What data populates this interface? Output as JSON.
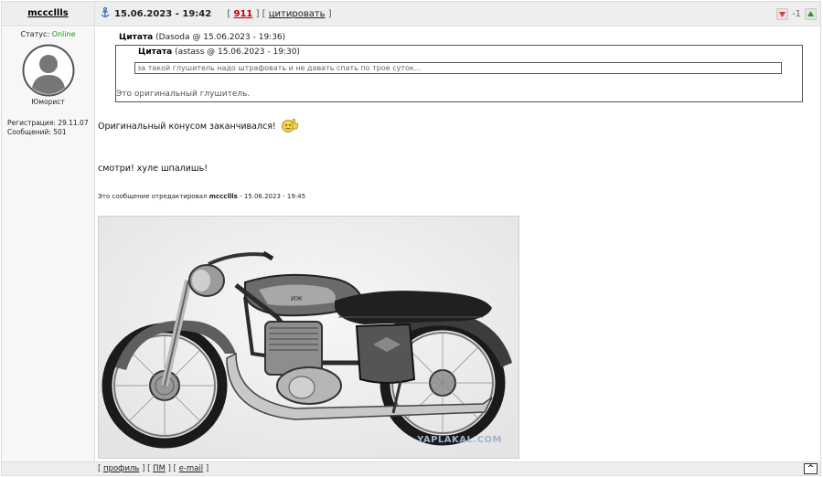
{
  "author": {
    "username": "mcccllls",
    "status_label": "Статус:",
    "status_value": "Online",
    "rank": "Юморист",
    "registration": "Регистрация: 29.11.07",
    "messages": "Сообщений: 501"
  },
  "header": {
    "date": "15.06.2023 - 19:42",
    "rating_open": "[",
    "rating": "911",
    "rating_mid": "] [",
    "quote_link": "цитировать",
    "rating_close": "]",
    "votes": "-1",
    "icons": [
      "anchor-icon",
      "thumb-down-icon",
      "thumb-up-icon"
    ]
  },
  "quote": {
    "outer_label": "Цитата",
    "outer_meta": "(Dasoda @ 15.06.2023 - 19:36)",
    "inner_label": "Цитата",
    "inner_meta": "(astass @ 15.06.2023 - 19:30)",
    "inner_text": "за такой глушитель надо штрафовать и не давать спать по трое суток...",
    "outer_text": "Это оригинальный глушитель."
  },
  "body": {
    "line1": "Оригинальный конусом заканчивался!",
    "line2": "смотри! хуле шпалишь!",
    "edited_prefix": "Это сообщение отредактировал",
    "edited_by": "mcccllls",
    "edited_time": "- 15.06.2023 - 19:45",
    "image_watermark": "YAPLAKAL.COM"
  },
  "footer": {
    "profile": "профиль",
    "pm": "ПМ",
    "email": "e-mail",
    "to_top": "^"
  },
  "colors": {
    "online": "#1a9a1a",
    "rating": "#c00000",
    "header_bg": "#eeeeee"
  }
}
